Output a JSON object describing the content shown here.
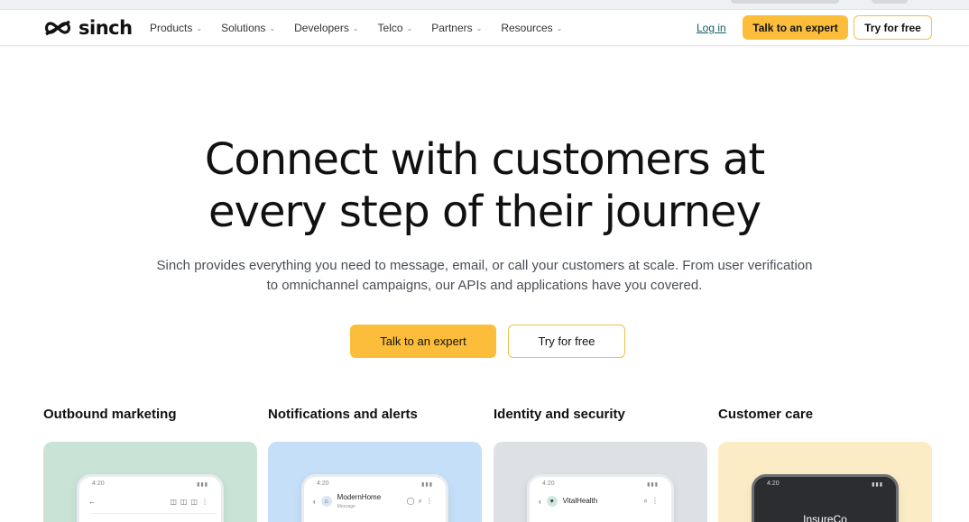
{
  "nav": {
    "logo_text": "sinch",
    "menu": [
      {
        "label": "Products"
      },
      {
        "label": "Solutions"
      },
      {
        "label": "Developers"
      },
      {
        "label": "Telco"
      },
      {
        "label": "Partners"
      },
      {
        "label": "Resources"
      }
    ],
    "login_label": "Log in",
    "talk_label": "Talk to an expert",
    "try_label": "Try for free"
  },
  "hero": {
    "title_line1": "Connect with customers at",
    "title_line2": "every step of their journey",
    "subtitle_line1": "Sinch provides everything you need to message, email, or call your customers at scale. From user verification",
    "subtitle_line2": "to omnichannel campaigns, our APIs and applications have you covered.",
    "talk_label": "Talk to an expert",
    "try_label": "Try for free"
  },
  "categories": [
    {
      "title": "Outbound marketing",
      "bg": "#c9e3d6",
      "phone_time": "4:20"
    },
    {
      "title": "Notifications and alerts",
      "bg": "#c4dff7",
      "phone_time": "4:20",
      "app_name": "ModernHome",
      "app_sub": "Message"
    },
    {
      "title": "Identity and security",
      "bg": "#dde1e5",
      "phone_time": "4:20",
      "app_name": "VitalHealth"
    },
    {
      "title": "Customer care",
      "bg": "#fbecc6",
      "phone_time": "4:20",
      "app_name": "InsureCo"
    }
  ],
  "colors": {
    "accent_yellow": "#fcbe3a",
    "login_teal": "#0f5f65"
  }
}
